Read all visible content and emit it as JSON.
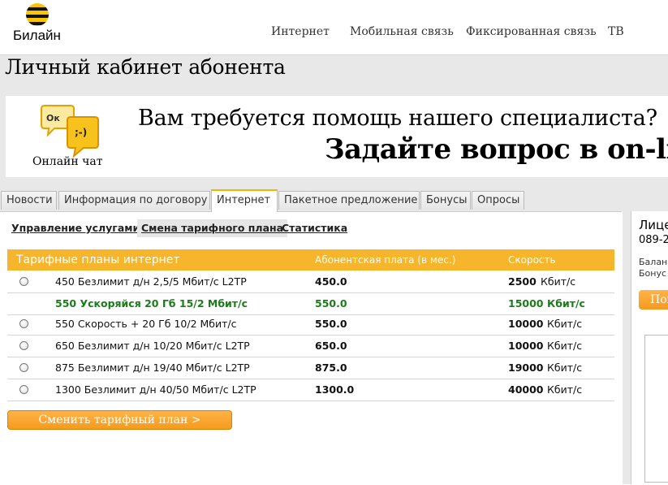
{
  "brand": {
    "name": "Билайн",
    "accent": "#f7b52b",
    "logo_stripe_dark": "#111111",
    "logo_stripe_yellow": "#f9c400"
  },
  "nav": [
    {
      "label": "Интернет"
    },
    {
      "label": "Мобильная связь"
    },
    {
      "label": "Фиксированная связь"
    },
    {
      "label": "ТВ"
    }
  ],
  "page": {
    "title": "Личный кабинет абонента"
  },
  "banner": {
    "chat_bubble_text_1": "Ок",
    "chat_bubble_text_2": ";-)",
    "chat_label": "Онлайн чат",
    "line1": "Вам требуется помощь нашего специалиста?",
    "line2": "Задайте вопрос в on-lin"
  },
  "tabs": [
    {
      "label": "Новости",
      "active": false
    },
    {
      "label": "Информация по договору",
      "active": false
    },
    {
      "label": "Интернет",
      "active": true
    },
    {
      "label": "Пакетное предложение",
      "active": false
    },
    {
      "label": "Бонусы",
      "active": false
    },
    {
      "label": "Опросы",
      "active": false
    }
  ],
  "subtabs": [
    {
      "label": "Управление услугами",
      "active": false
    },
    {
      "label": "Смена тарифного плана",
      "active": true
    },
    {
      "label": "Статистика",
      "active": false
    }
  ],
  "tariff_table": {
    "headers": [
      "Тарифные планы интернет",
      "Абонентская плата (в мес.)",
      "Скорость"
    ],
    "rows": [
      {
        "name": "450 Безлимит д/н 2,5/5 Мбит/с L2TP",
        "fee": "450.0",
        "speed_value": "2500",
        "speed_unit": "Кбит/с",
        "current": false
      },
      {
        "name": "550 Ускоряйся 20 Гб 15/2 Мбит/с",
        "fee": "550.0",
        "speed_value": "15000",
        "speed_unit": "Кбит/с",
        "current": true
      },
      {
        "name": "550 Скорость + 20 Гб 10/2 Мбит/с",
        "fee": "550.0",
        "speed_value": "10000",
        "speed_unit": "Кбит/с",
        "current": false
      },
      {
        "name": "650 Безлимит д/н 10/20 Мбит/с L2TP",
        "fee": "650.0",
        "speed_value": "10000",
        "speed_unit": "Кбит/с",
        "current": false
      },
      {
        "name": "875 Безлимит д/н 19/40 Мбит/с L2TP",
        "fee": "875.0",
        "speed_value": "19000",
        "speed_unit": "Кбит/с",
        "current": false
      },
      {
        "name": "1300 Безлимит д/н 40/50 Мбит/с L2TP",
        "fee": "1300.0",
        "speed_value": "40000",
        "speed_unit": "Кбит/с",
        "current": false
      }
    ]
  },
  "change_button": {
    "label": "Сменить тарифный план >"
  },
  "right_panel": {
    "title": "Лице",
    "number": "089-2",
    "balance": "Балан",
    "bonus": "Бонус",
    "button": "Пог"
  }
}
